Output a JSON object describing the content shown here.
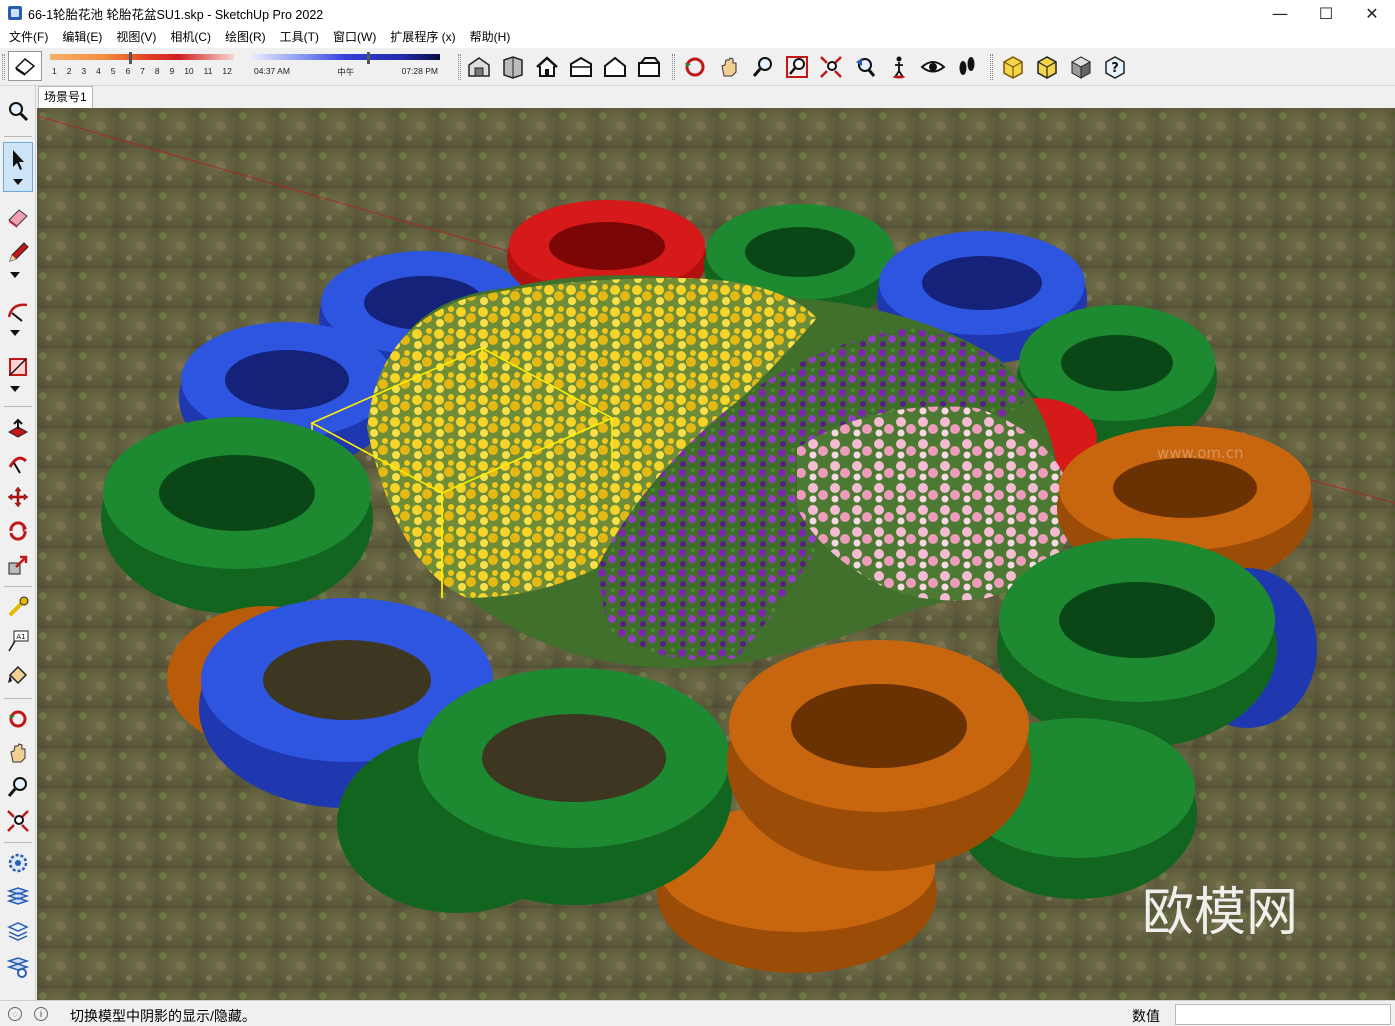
{
  "window": {
    "title": "66-1轮胎花池 轮胎花盆SU1.skp - SketchUp Pro 2022",
    "minimize": "—",
    "maximize": "☐",
    "close": "✕"
  },
  "menu": [
    "文件(F)",
    "编辑(E)",
    "视图(V)",
    "相机(C)",
    "绘图(R)",
    "工具(T)",
    "窗口(W)",
    "扩展程序 (x)",
    "帮助(H)"
  ],
  "shadow": {
    "months": [
      "1",
      "2",
      "3",
      "4",
      "5",
      "6",
      "7",
      "8",
      "9",
      "10",
      "11",
      "12"
    ],
    "month_value": 0.44,
    "time_start": "04:37 AM",
    "time_mid": "中午",
    "time_end": "07:28 PM",
    "time_value": 0.62
  },
  "toolbar_icons": [
    "warehouse-icon",
    "component-icon",
    "house-icon",
    "house-top-icon",
    "house-front-icon",
    "house-side-icon",
    "orbit-icon",
    "pan-icon",
    "zoom-icon",
    "zoom-window-icon",
    "zoom-extents-icon",
    "previous-view-icon",
    "position-camera-icon",
    "look-around-icon",
    "walk-icon",
    "xray-icon",
    "back-edges-icon",
    "shaded-icon",
    "help-icon"
  ],
  "scene_tab": "场景号1",
  "watermark": "欧模网",
  "watermark_small": "www.om.cn",
  "status": {
    "text": "切换模型中阴影的显示/隐藏。",
    "measure_label": "数值",
    "measure_value": ""
  },
  "colors": {
    "tire_red": "#c81414",
    "tire_green": "#177a2a",
    "tire_blue": "#2447d4",
    "tire_orange": "#b85c0a",
    "flower_yellow": "#f3d12a",
    "flower_purple": "#7a2aa8",
    "flower_pink": "#f0b6cc",
    "selection": "#ffee00"
  }
}
